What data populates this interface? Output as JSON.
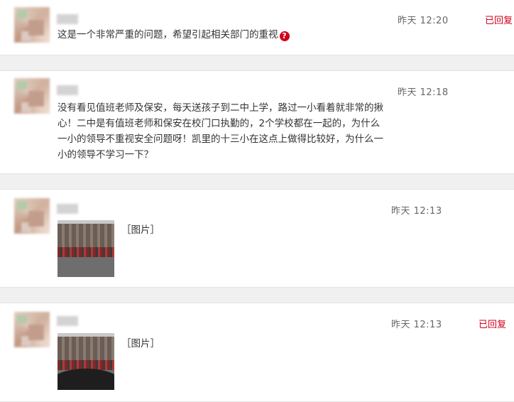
{
  "comments": [
    {
      "time": "昨天  12:20",
      "status": "已回复",
      "text_lines": [
        "这是一个非常严重的问题，希望引起相关部门的重视"
      ],
      "emoji": "?"
    },
    {
      "time": "昨天  12:18",
      "text_lines": [
        "没有看见值班老师及保安，每天送孩子到二中上学，路过一小看着就非常的揪",
        "心！二中是有值班老师和保安在校门口执勤的，2个学校都在一起的，为什么",
        "一小的领导不重视安全问题呀！凯里的十三小在这点上做得比较好，为什么一",
        "小的领导不学习一下？"
      ]
    },
    {
      "time": "昨天  12:13",
      "image_label": "［图片］"
    },
    {
      "time": "昨天  12:13",
      "status": "已回复",
      "image_label": "［图片］"
    }
  ],
  "colors": {
    "status": "#d0021b",
    "time": "#666666",
    "text": "#333333"
  }
}
